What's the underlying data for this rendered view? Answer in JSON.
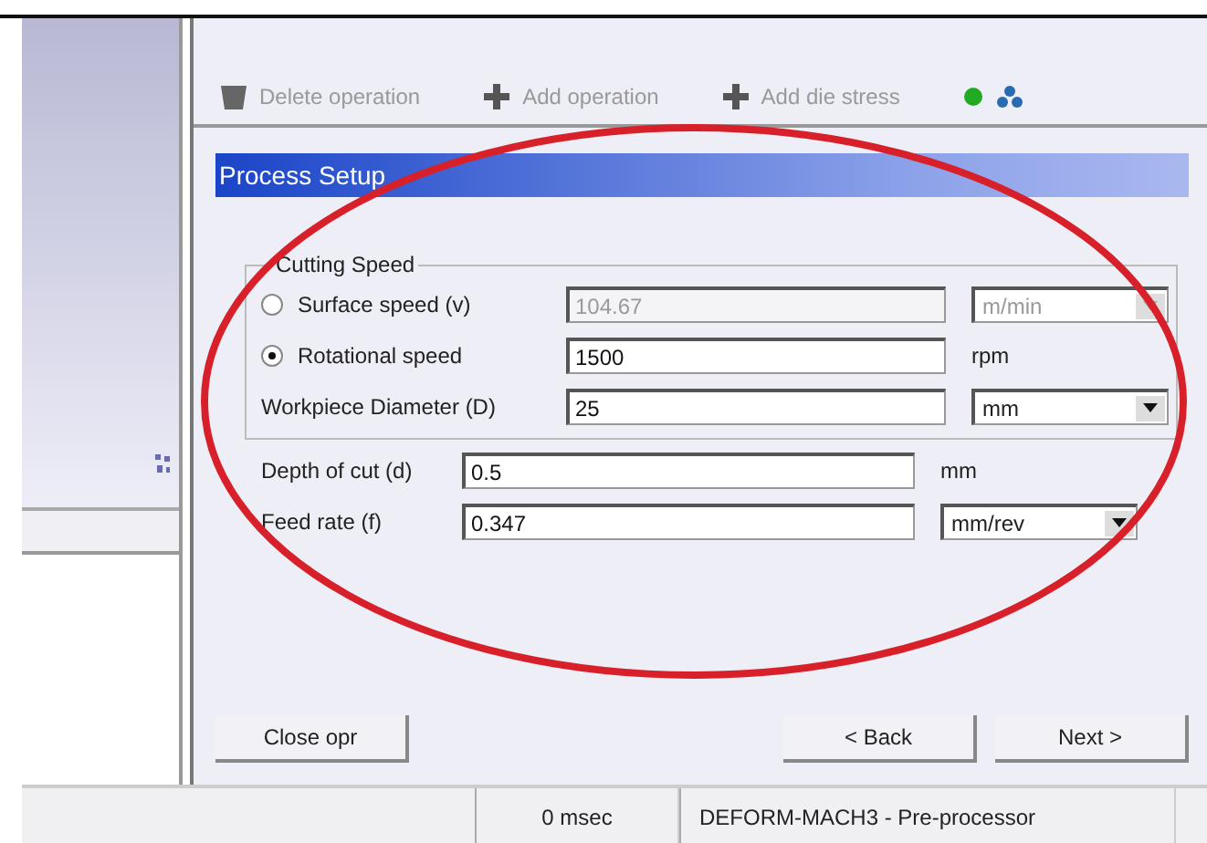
{
  "toolbar": [
    {
      "kind": "trash",
      "label": "Delete operation"
    },
    {
      "kind": "plus",
      "label": "Add operation"
    },
    {
      "kind": "plus",
      "label": "Add die stress"
    }
  ],
  "panel": {
    "title": "Process Setup"
  },
  "cutting_speed": {
    "title": "Cutting Speed",
    "rows": [
      {
        "kind": "radio",
        "label": "Surface speed (v)",
        "selected": false,
        "value": "104.67",
        "disabled": true,
        "unit": "m/min",
        "dropdown": true
      },
      {
        "kind": "radio",
        "label": "Rotational speed",
        "selected": true,
        "value": "1500",
        "disabled": false,
        "unit": "rpm",
        "dropdown": false
      },
      {
        "kind": "plain",
        "label": "Workpiece Diameter (D)",
        "value": "25",
        "disabled": false,
        "unit": "mm",
        "dropdown": true
      }
    ]
  },
  "fields": [
    {
      "label": "Depth of cut (d)",
      "value": "0.5",
      "unit": "mm",
      "dropdown": false
    },
    {
      "label": "Feed rate (f)",
      "value": "0.347",
      "unit": "mm/rev",
      "dropdown": true
    }
  ],
  "buttons": {
    "close": "Close opr",
    "back": "< Back",
    "next": "Next >"
  },
  "status_bar": [
    "0 msec",
    "DEFORM-MACH3  -  Pre-processor"
  ]
}
